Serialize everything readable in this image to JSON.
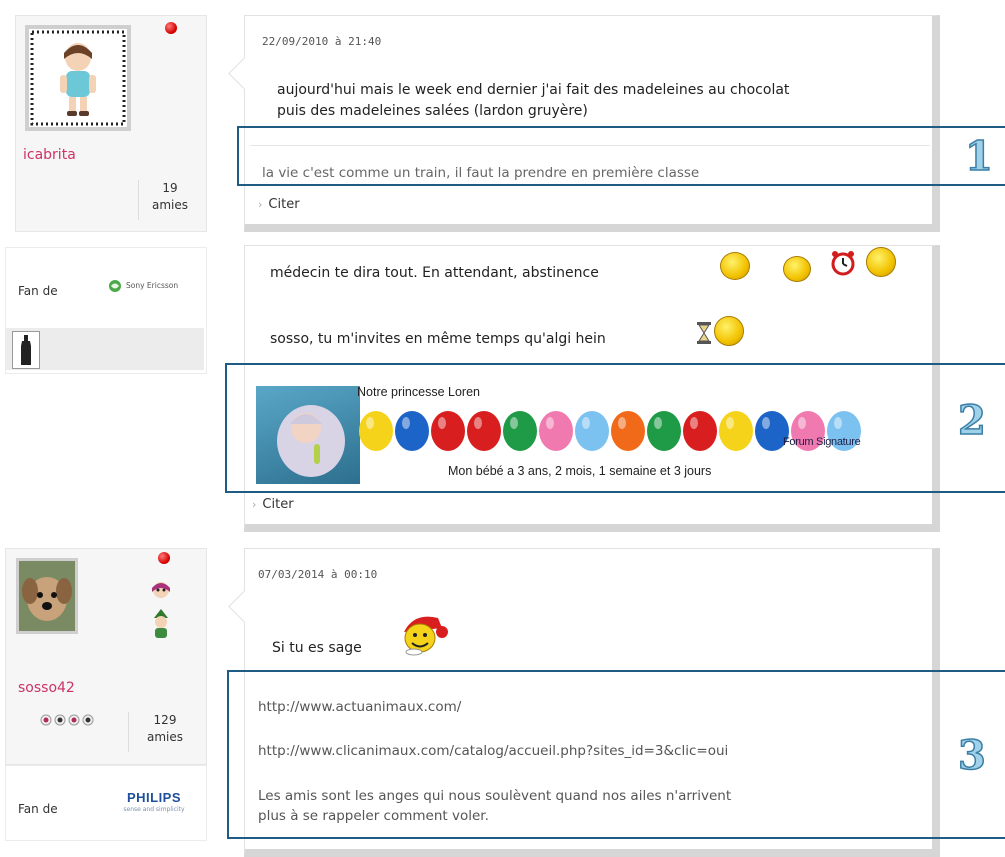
{
  "posts": [
    {
      "user": {
        "name": "icabrita",
        "friends_count": "19",
        "friends_label": "amies"
      },
      "date": "22/09/2010 à 21:40",
      "message_lines": [
        "aujourd'hui mais le week end dernier j'ai fait des madeleines au chocolat",
        "puis des madeleines salées (lardon gruyère)"
      ],
      "signature": "la vie c'est comme un train, il faut la prendre en première classe",
      "quote_label": "Citer",
      "annotation_number": "1"
    },
    {
      "fan": {
        "label": "Fan de",
        "brand": "Sony Ericsson"
      },
      "message_lines": [
        "médecin te dira tout. En attendant, abstinence",
        "sosso, tu m'invites en même temps qu'algi hein"
      ],
      "signature_banner": {
        "title": "Notre princesse Loren",
        "watermark": "Forum Signature",
        "caption": "Mon bébé a 3 ans, 2 mois, 1 semaine et 3 jours",
        "balloon_colors": [
          "#f5d31a",
          "#1d64c8",
          "#d81e1e",
          "#d81e1e",
          "#1f9a46",
          "#f07ab0",
          "#7cc2f0",
          "#f06a1a",
          "#1f9a46",
          "#d81e1e",
          "#f5d31a",
          "#1d64c8",
          "#f07ab0",
          "#7cc2f0"
        ]
      },
      "quote_label": "Citer",
      "annotation_number": "2"
    },
    {
      "user": {
        "name": "sosso42",
        "friends_count": "129",
        "friends_label": "amies"
      },
      "fan": {
        "label": "Fan de",
        "brand": "PHILIPS",
        "tagline": "sense and simplicity"
      },
      "date": "07/03/2014 à 00:10",
      "message": "Si tu es sage",
      "signature_lines": [
        "http://www.actuanimaux.com/",
        "http://www.clicanimaux.com/catalog/accueil.php?sites_id=3&clic=oui",
        "Les amis sont les anges qui nous soulèvent quand nos ailes n'arrivent",
        "plus à se rappeler comment voler."
      ],
      "annotation_number": "3"
    }
  ],
  "colors": {
    "username": "#cc3366",
    "highlight_border": "#1f5c85",
    "annotation_fill": "#9fd1e8",
    "online": "#d40000"
  }
}
